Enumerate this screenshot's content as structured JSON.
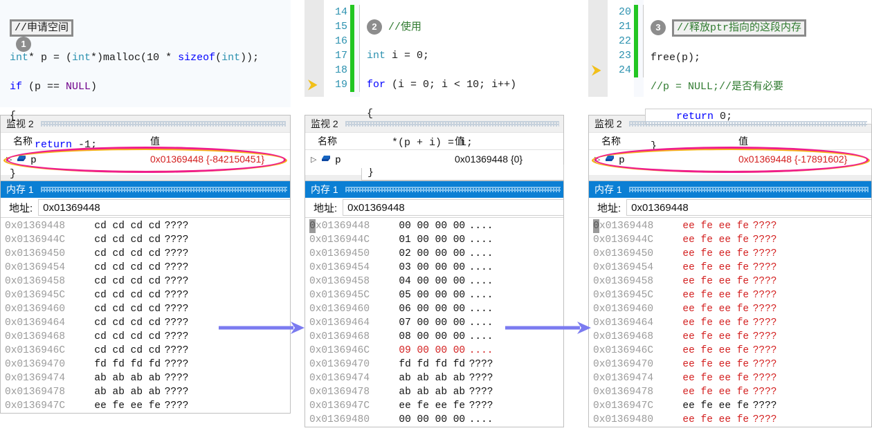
{
  "panels": [
    {
      "id": "step-1",
      "badge": "1",
      "editor": {
        "show_linenos": false,
        "lines": [
          {
            "n": "",
            "html_key": "comment_box",
            "text": "//申请空间"
          },
          {
            "n": "",
            "text": "int* p = (int*)malloc(10 * sizeof(int));"
          },
          {
            "n": "",
            "text": "if (p == NULL)"
          },
          {
            "n": "",
            "text": "{"
          },
          {
            "n": "",
            "text": "    return -1;"
          },
          {
            "n": "",
            "text": "}"
          }
        ]
      },
      "watch": {
        "title": "监视 2",
        "col_name": "名称",
        "col_value": "值",
        "row_name": "p",
        "row_value": "0x01369448 {-842150451}",
        "value_color": "#d31f1f",
        "highlighted": true
      },
      "memory": {
        "title": "内存 1",
        "address_label": "地址:",
        "address_value": "0x01369448",
        "rows": [
          {
            "addr": "0x01369448",
            "bytes": "cd cd cd cd",
            "ascii": "????",
            "color": "black"
          },
          {
            "addr": "0x0136944C",
            "bytes": "cd cd cd cd",
            "ascii": "????",
            "color": "black"
          },
          {
            "addr": "0x01369450",
            "bytes": "cd cd cd cd",
            "ascii": "????",
            "color": "black"
          },
          {
            "addr": "0x01369454",
            "bytes": "cd cd cd cd",
            "ascii": "????",
            "color": "black"
          },
          {
            "addr": "0x01369458",
            "bytes": "cd cd cd cd",
            "ascii": "????",
            "color": "black"
          },
          {
            "addr": "0x0136945C",
            "bytes": "cd cd cd cd",
            "ascii": "????",
            "color": "black"
          },
          {
            "addr": "0x01369460",
            "bytes": "cd cd cd cd",
            "ascii": "????",
            "color": "black"
          },
          {
            "addr": "0x01369464",
            "bytes": "cd cd cd cd",
            "ascii": "????",
            "color": "black"
          },
          {
            "addr": "0x01369468",
            "bytes": "cd cd cd cd",
            "ascii": "????",
            "color": "black"
          },
          {
            "addr": "0x0136946C",
            "bytes": "cd cd cd cd",
            "ascii": "????",
            "color": "black"
          },
          {
            "addr": "0x01369470",
            "bytes": "fd fd fd fd",
            "ascii": "????",
            "color": "black"
          },
          {
            "addr": "0x01369474",
            "bytes": "ab ab ab ab",
            "ascii": "????",
            "color": "black"
          },
          {
            "addr": "0x01369478",
            "bytes": "ab ab ab ab",
            "ascii": "????",
            "color": "black"
          },
          {
            "addr": "0x0136947C",
            "bytes": "ee fe ee fe",
            "ascii": "????",
            "color": "black"
          }
        ]
      }
    },
    {
      "id": "step-2",
      "badge": "2",
      "editor": {
        "show_linenos": true,
        "lines": [
          {
            "n": "14",
            "text": "//使用"
          },
          {
            "n": "15",
            "text": "int i = 0;"
          },
          {
            "n": "16",
            "text": "for (i = 0; i < 10; i++)"
          },
          {
            "n": "17",
            "text": "{"
          },
          {
            "n": "18",
            "text": "    *(p + i) = i;"
          },
          {
            "n": "19",
            "text": "}"
          }
        ],
        "current_line": "19"
      },
      "watch": {
        "title": "监视 2",
        "col_name": "名称",
        "col_value": "值",
        "row_name": "p",
        "row_value": "0x01369448 {0}",
        "value_color": "#111111",
        "highlighted": false
      },
      "memory": {
        "title": "内存 1",
        "address_label": "地址:",
        "address_value": "0x01369448",
        "rows": [
          {
            "addr": "0x01369448",
            "bytes": "00 00 00 00",
            "ascii": "....",
            "color": "black"
          },
          {
            "addr": "0x0136944C",
            "bytes": "01 00 00 00",
            "ascii": "....",
            "color": "black"
          },
          {
            "addr": "0x01369450",
            "bytes": "02 00 00 00",
            "ascii": "....",
            "color": "black"
          },
          {
            "addr": "0x01369454",
            "bytes": "03 00 00 00",
            "ascii": "....",
            "color": "black"
          },
          {
            "addr": "0x01369458",
            "bytes": "04 00 00 00",
            "ascii": "....",
            "color": "black"
          },
          {
            "addr": "0x0136945C",
            "bytes": "05 00 00 00",
            "ascii": "....",
            "color": "black"
          },
          {
            "addr": "0x01369460",
            "bytes": "06 00 00 00",
            "ascii": "....",
            "color": "black"
          },
          {
            "addr": "0x01369464",
            "bytes": "07 00 00 00",
            "ascii": "....",
            "color": "black"
          },
          {
            "addr": "0x01369468",
            "bytes": "08 00 00 00",
            "ascii": "....",
            "color": "black"
          },
          {
            "addr": "0x0136946C",
            "bytes": "09 00 00 00",
            "ascii": "....",
            "color": "red"
          },
          {
            "addr": "0x01369470",
            "bytes": "fd fd fd fd",
            "ascii": "????",
            "color": "black"
          },
          {
            "addr": "0x01369474",
            "bytes": "ab ab ab ab",
            "ascii": "????",
            "color": "black"
          },
          {
            "addr": "0x01369478",
            "bytes": "ab ab ab ab",
            "ascii": "????",
            "color": "black"
          },
          {
            "addr": "0x0136947C",
            "bytes": "ee fe ee fe",
            "ascii": "????",
            "color": "black"
          },
          {
            "addr": "0x01369480",
            "bytes": "00 00 00 00",
            "ascii": "....",
            "color": "black"
          }
        ]
      }
    },
    {
      "id": "step-3",
      "badge": "3",
      "editor": {
        "show_linenos": true,
        "lines": [
          {
            "n": "20",
            "text": "//释放ptr指向的这段内存"
          },
          {
            "n": "21",
            "text": "free(p);"
          },
          {
            "n": "22",
            "text": "//p = NULL;//是否有必要"
          },
          {
            "n": "23",
            "text": "    return 0;"
          },
          {
            "n": "24",
            "text": "}"
          }
        ],
        "current_line": "23"
      },
      "watch": {
        "title": "监视 2",
        "col_name": "名称",
        "col_value": "值",
        "row_name": "p",
        "row_value": "0x01369448 {-17891602}",
        "value_color": "#d31f1f",
        "highlighted": true
      },
      "memory": {
        "title": "内存 1",
        "address_label": "地址:",
        "address_value": "0x01369448",
        "rows": [
          {
            "addr": "0x01369448",
            "bytes": "ee fe ee fe",
            "ascii": "????",
            "color": "red"
          },
          {
            "addr": "0x0136944C",
            "bytes": "ee fe ee fe",
            "ascii": "????",
            "color": "red"
          },
          {
            "addr": "0x01369450",
            "bytes": "ee fe ee fe",
            "ascii": "????",
            "color": "red"
          },
          {
            "addr": "0x01369454",
            "bytes": "ee fe ee fe",
            "ascii": "????",
            "color": "red"
          },
          {
            "addr": "0x01369458",
            "bytes": "ee fe ee fe",
            "ascii": "????",
            "color": "red"
          },
          {
            "addr": "0x0136945C",
            "bytes": "ee fe ee fe",
            "ascii": "????",
            "color": "red"
          },
          {
            "addr": "0x01369460",
            "bytes": "ee fe ee fe",
            "ascii": "????",
            "color": "red"
          },
          {
            "addr": "0x01369464",
            "bytes": "ee fe ee fe",
            "ascii": "????",
            "color": "red"
          },
          {
            "addr": "0x01369468",
            "bytes": "ee fe ee fe",
            "ascii": "????",
            "color": "red"
          },
          {
            "addr": "0x0136946C",
            "bytes": "ee fe ee fe",
            "ascii": "????",
            "color": "red"
          },
          {
            "addr": "0x01369470",
            "bytes": "ee fe ee fe",
            "ascii": "????",
            "color": "red"
          },
          {
            "addr": "0x01369474",
            "bytes": "ee fe ee fe",
            "ascii": "????",
            "color": "red"
          },
          {
            "addr": "0x01369478",
            "bytes": "ee fe ee fe",
            "ascii": "????",
            "color": "red"
          },
          {
            "addr": "0x0136947C",
            "bytes": "ee fe ee fe",
            "ascii": "????",
            "color": "black"
          },
          {
            "addr": "0x01369480",
            "bytes": "ee fe ee fe",
            "ascii": "????",
            "color": "red"
          }
        ]
      }
    }
  ],
  "flow_arrows": [
    {
      "name": "flow-arrow-1-to-2",
      "color": "#7b7bf0"
    },
    {
      "name": "flow-arrow-2-to-3",
      "color": "#7b7bf0"
    }
  ],
  "icons": {
    "expand_triangle": "▷",
    "cube": "cube-icon",
    "current_statement_arrow": "⇨"
  }
}
